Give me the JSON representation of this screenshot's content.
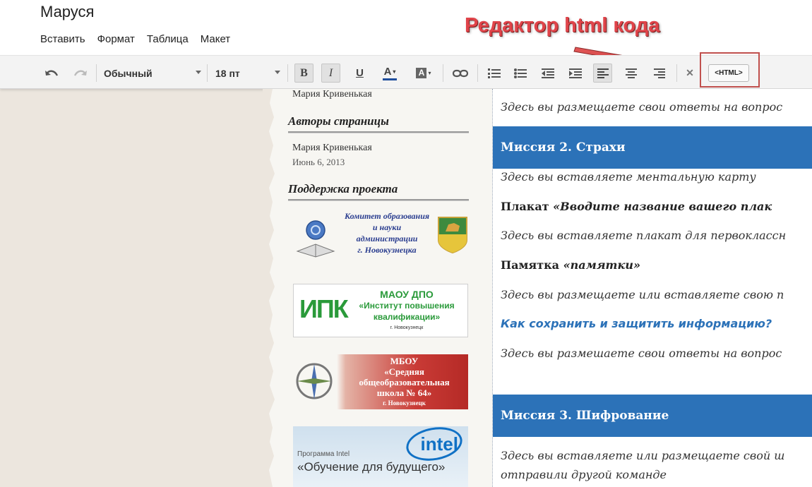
{
  "app": {
    "doc_title": "Маруся",
    "menu": [
      "Вставить",
      "Формат",
      "Таблица",
      "Макет"
    ]
  },
  "toolbar": {
    "style_select": "Обычный",
    "size_select": "18 пт",
    "bold_label": "B",
    "italic_label": "I",
    "underline_label": "U",
    "text_color_label": "A",
    "highlight_label": "A",
    "html_label": "<HTML>",
    "colors": {
      "text_color_bar": "#1f4e9c",
      "annotation": "#e0444a"
    }
  },
  "annotation": "Редактор html кода",
  "sidebar": {
    "top_name": "Мария Кривенькая",
    "authors_heading": "Авторы страницы",
    "author_name": "Мария Кривенькая",
    "author_date": "Июнь 6, 2013",
    "support_heading": "Поддержка проекта",
    "logos": {
      "committee": [
        "Комитет образования",
        "и науки",
        "администрации",
        "г. Новокузнецка"
      ],
      "ipk_abbr": "ИПК",
      "ipk": [
        "МАОУ ДПО",
        "«Институт повышения",
        "квалификации»",
        "г. Новокузнецк"
      ],
      "school": [
        "МБОУ",
        "«Средняя",
        "общеобразовательная",
        "школа № 64»",
        "г. Новокузнецк"
      ],
      "intel_brand": "intel",
      "intel": [
        "Программа Intel",
        "«Обучение для будущего»"
      ]
    }
  },
  "main": {
    "line1": "Здесь вы размещаете свои ответы на вопрос",
    "mission2": "Миссия 2. Страхи",
    "line2": "Здесь вы вставляете ментальную карту",
    "poster_prefix": "Плакат ",
    "poster_title": "«Вводите название вашего плак",
    "line3": "Здесь вы вставляете плакат для первоклассн",
    "memo_prefix": "Памятка ",
    "memo_title": "«памятки»",
    "line4": "Здесь вы размещаете или вставляете свою п",
    "link": "Как сохранить и защитить информацию?",
    "line5": "Здесь вы размешаете свои ответы на вопрос",
    "mission3": "Миссия 3. Шифрование",
    "line6a": "Здесь вы вставляете или размещаете свой ш",
    "line6b": "отправили другой команде"
  }
}
